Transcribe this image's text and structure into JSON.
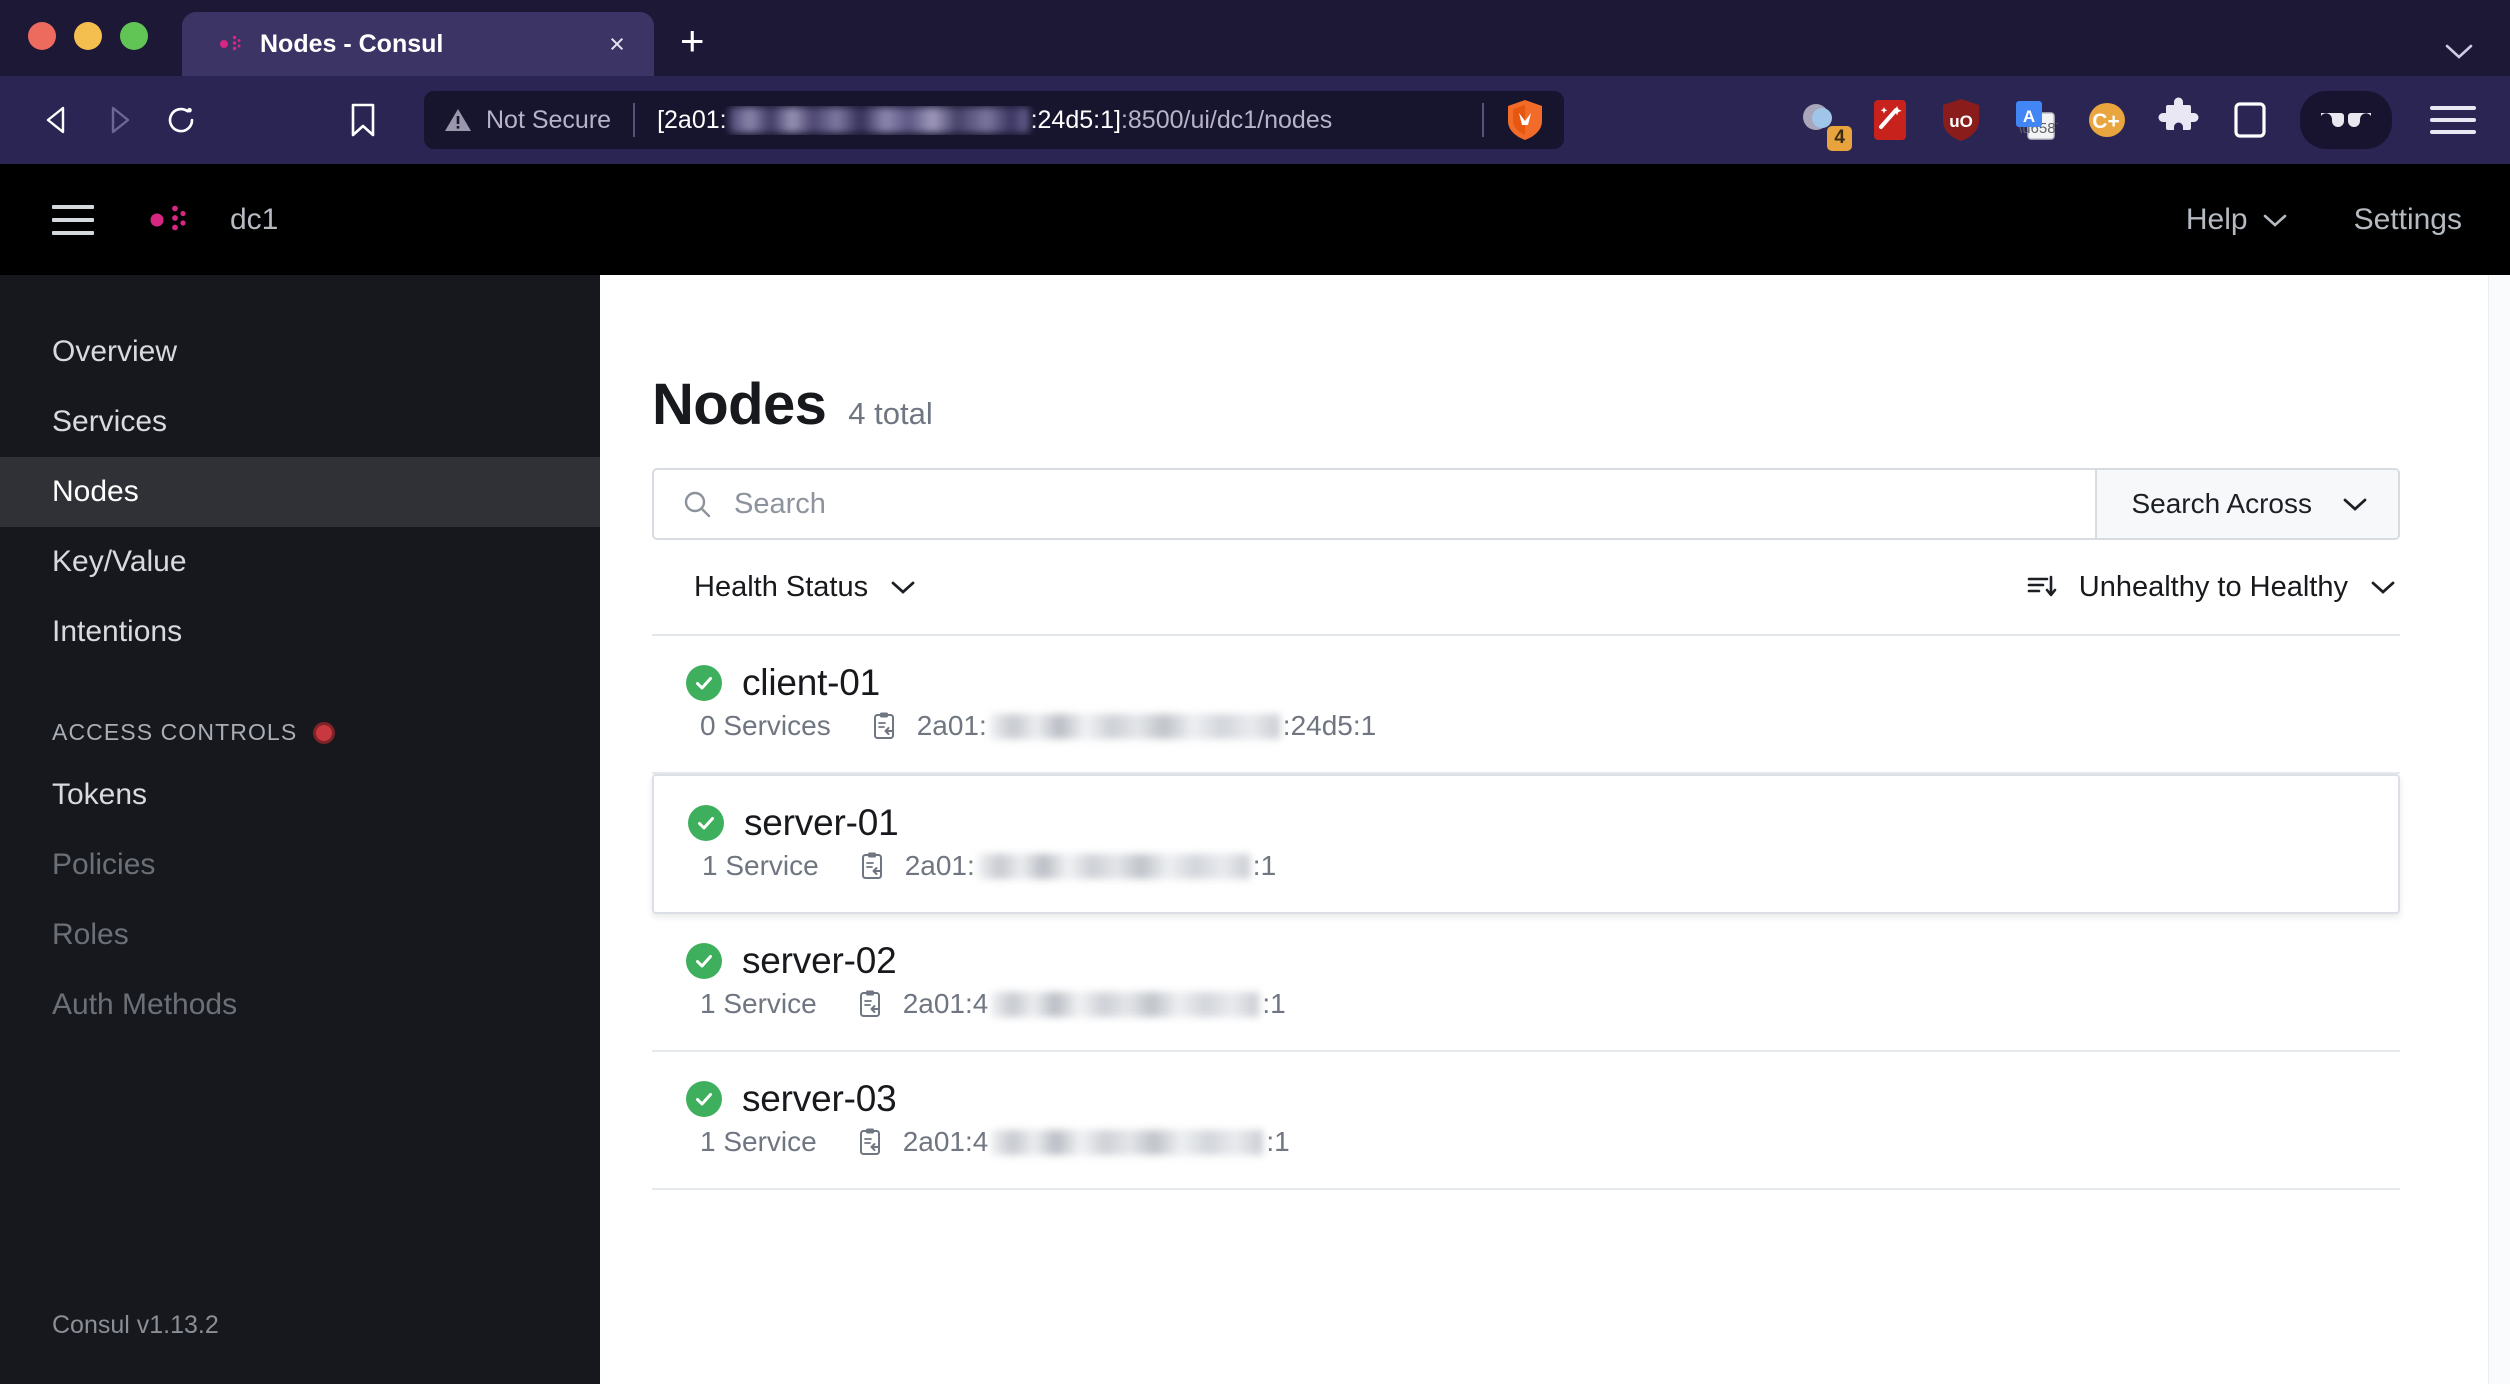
{
  "browser": {
    "tab": {
      "title": "Nodes - Consul",
      "favicon": "consul-logo-icon",
      "close_label": "×"
    },
    "new_tab_label": "+",
    "tab_list_chevron": "⌄",
    "nav": {
      "back": "back-arrow-icon",
      "forward": "forward-arrow-icon",
      "reload": "reload-icon",
      "bookmark": "bookmark-icon"
    },
    "omnibox": {
      "security_label": "Not Secure",
      "security_icon": "warning-triangle-icon",
      "url_prefix": "[2a01:",
      "url_redacted": "",
      "url_mid": ":24d5:1]",
      "url_suffix": ":8500/ui/dc1/nodes",
      "shield_icon": "brave-shield-icon"
    },
    "extensions": [
      {
        "name": "tab-groups-icon",
        "badge": "4"
      },
      {
        "name": "magic-wand-extension-icon",
        "badge": ""
      },
      {
        "name": "ublock-origin-icon",
        "badge": ""
      },
      {
        "name": "google-translate-icon",
        "badge": ""
      },
      {
        "name": "c-plus-extension-icon",
        "badge": ""
      },
      {
        "name": "puzzle-extensions-icon",
        "badge": ""
      },
      {
        "name": "sidebar-toggle-icon",
        "badge": ""
      },
      {
        "name": "reader-glasses-icon",
        "badge": ""
      }
    ],
    "menu_icon": "hamburger-menu-icon"
  },
  "app": {
    "topbar": {
      "menu_icon": "hamburger-icon",
      "logo": "consul-logo-icon",
      "datacenter": "dc1",
      "help_label": "Help",
      "help_chevron": "⌄",
      "settings_label": "Settings"
    },
    "sidebar": {
      "items": [
        {
          "label": "Overview",
          "state": "normal"
        },
        {
          "label": "Services",
          "state": "normal"
        },
        {
          "label": "Nodes",
          "state": "active"
        },
        {
          "label": "Key/Value",
          "state": "normal"
        },
        {
          "label": "Intentions",
          "state": "normal"
        }
      ],
      "section": {
        "label": "ACCESS CONTROLS",
        "status_dot_color": "#c7393f"
      },
      "acl_items": [
        {
          "label": "Tokens",
          "state": "normal"
        },
        {
          "label": "Policies",
          "state": "muted"
        },
        {
          "label": "Roles",
          "state": "muted"
        },
        {
          "label": "Auth Methods",
          "state": "muted"
        }
      ],
      "footer": "Consul v1.13.2"
    },
    "main": {
      "title": "Nodes",
      "count": "4 total",
      "search": {
        "icon": "search-icon",
        "placeholder": "Search",
        "value": "",
        "across_label": "Search Across",
        "across_chevron": "⌄"
      },
      "filters": {
        "health_label": "Health Status",
        "health_chevron": "⌄",
        "sort_icon": "sort-descending-icon",
        "sort_label": "Unhealthy to Healthy",
        "sort_chevron": "⌄"
      },
      "nodes": [
        {
          "name": "client-01",
          "health": "passing",
          "health_icon": "check-circle-icon",
          "services": "0 Services",
          "copy_icon": "copy-address-icon",
          "addr_prefix": "2a01:",
          "addr_suffix": ":24d5:1",
          "hovered": false
        },
        {
          "name": "server-01",
          "health": "passing",
          "health_icon": "check-circle-icon",
          "services": "1 Service",
          "copy_icon": "copy-address-icon",
          "addr_prefix": "2a01:",
          "addr_suffix": ":1",
          "hovered": true
        },
        {
          "name": "server-02",
          "health": "passing",
          "health_icon": "check-circle-icon",
          "services": "1 Service",
          "copy_icon": "copy-address-icon",
          "addr_prefix": "2a01:4",
          "addr_suffix": ":1",
          "hovered": false
        },
        {
          "name": "server-03",
          "health": "passing",
          "health_icon": "check-circle-icon",
          "services": "1 Service",
          "copy_icon": "copy-address-icon",
          "addr_prefix": "2a01:4",
          "addr_suffix": ":1",
          "hovered": false
        }
      ]
    }
  },
  "colors": {
    "brand_pink": "#d62783",
    "browser_chrome": "#2b2553",
    "tabstrip": "#1c1836",
    "topbar_black": "#000000",
    "sidebar": "#16181d",
    "sidebar_active": "#2f3137",
    "health_green": "#3eaf5d",
    "acl_red": "#c7393f"
  }
}
